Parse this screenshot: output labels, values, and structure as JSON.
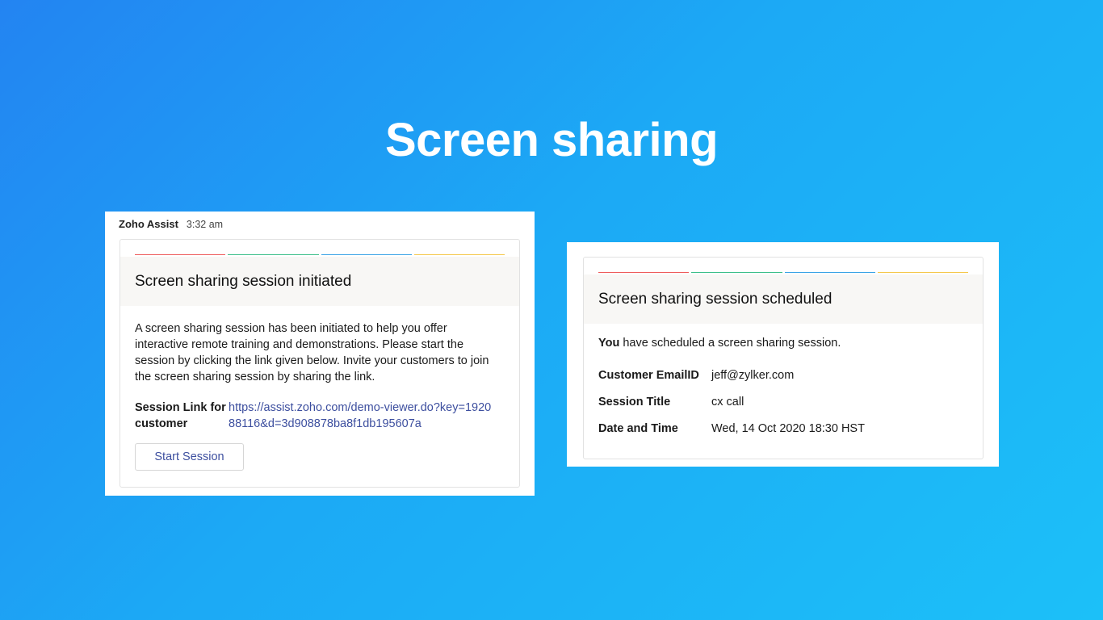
{
  "hero": {
    "title": "Screen sharing"
  },
  "colors": {
    "bar_red": "#ee5b5b",
    "bar_green": "#3cbf8a",
    "bar_blue": "#3aa3e6",
    "bar_yellow": "#f5c84c",
    "link": "#3d4f9f"
  },
  "left_message": {
    "sender": "Zoho Assist",
    "time": "3:32 am",
    "card": {
      "title": "Screen sharing session initiated",
      "description": "A screen sharing session has been initiated to help you offer interactive remote training and demonstrations. Please start the session by clicking the link given below. Invite your customers to join the screen sharing session by sharing the link.",
      "link_label": "Session Link for customer",
      "link_value": "https://assist.zoho.com/demo-viewer.do?key=192088116&d=3d908878ba8f1db195607a",
      "button_label": "Start Session"
    }
  },
  "right_message": {
    "card": {
      "title": "Screen sharing session scheduled",
      "intro_bold": "You",
      "intro_rest": " have scheduled a screen sharing session.",
      "details": [
        {
          "label": "Customer EmailID",
          "value": "jeff@zylker.com"
        },
        {
          "label": "Session Title",
          "value": "cx call"
        },
        {
          "label": "Date and Time",
          "value": "Wed, 14 Oct 2020 18:30 HST"
        }
      ]
    }
  }
}
